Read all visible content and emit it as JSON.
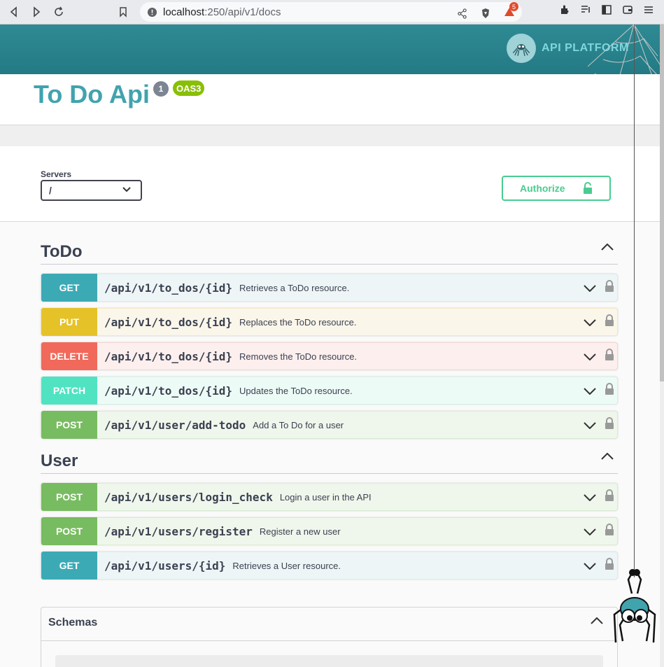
{
  "browser": {
    "url_host": "localhost",
    "url_path": ":250/api/v1/docs",
    "brave_badge": "5"
  },
  "brand": {
    "name": "API PLATFORM"
  },
  "info": {
    "title": "To Do Api",
    "version": "1",
    "oas": "OAS3"
  },
  "servers": {
    "label": "Servers",
    "selected": "/"
  },
  "authorize": {
    "label": "Authorize"
  },
  "sections": [
    {
      "name": "ToDo",
      "ops": [
        {
          "method": "GET",
          "path": "/api/v1/to_dos/{id}",
          "summary": "Retrieves a ToDo resource."
        },
        {
          "method": "PUT",
          "path": "/api/v1/to_dos/{id}",
          "summary": "Replaces the ToDo resource."
        },
        {
          "method": "DELETE",
          "path": "/api/v1/to_dos/{id}",
          "summary": "Removes the ToDo resource."
        },
        {
          "method": "PATCH",
          "path": "/api/v1/to_dos/{id}",
          "summary": "Updates the ToDo resource."
        },
        {
          "method": "POST",
          "path": "/api/v1/user/add-todo",
          "summary": "Add a To Do for a user"
        }
      ]
    },
    {
      "name": "User",
      "ops": [
        {
          "method": "POST",
          "path": "/api/v1/users/login_check",
          "summary": "Login a user in the API"
        },
        {
          "method": "POST",
          "path": "/api/v1/users/register",
          "summary": "Register a new user"
        },
        {
          "method": "GET",
          "path": "/api/v1/users/{id}",
          "summary": "Retrieves a User resource."
        }
      ]
    }
  ],
  "schemas": {
    "title": "Schemas"
  },
  "colors": {
    "topbar": "#288690",
    "title": "#41a3ad",
    "get": "#3caab5",
    "put": "#e6c229",
    "delete": "#f0695a",
    "patch": "#50e3c2",
    "post": "#78bc61",
    "authorize": "#49cc90"
  }
}
